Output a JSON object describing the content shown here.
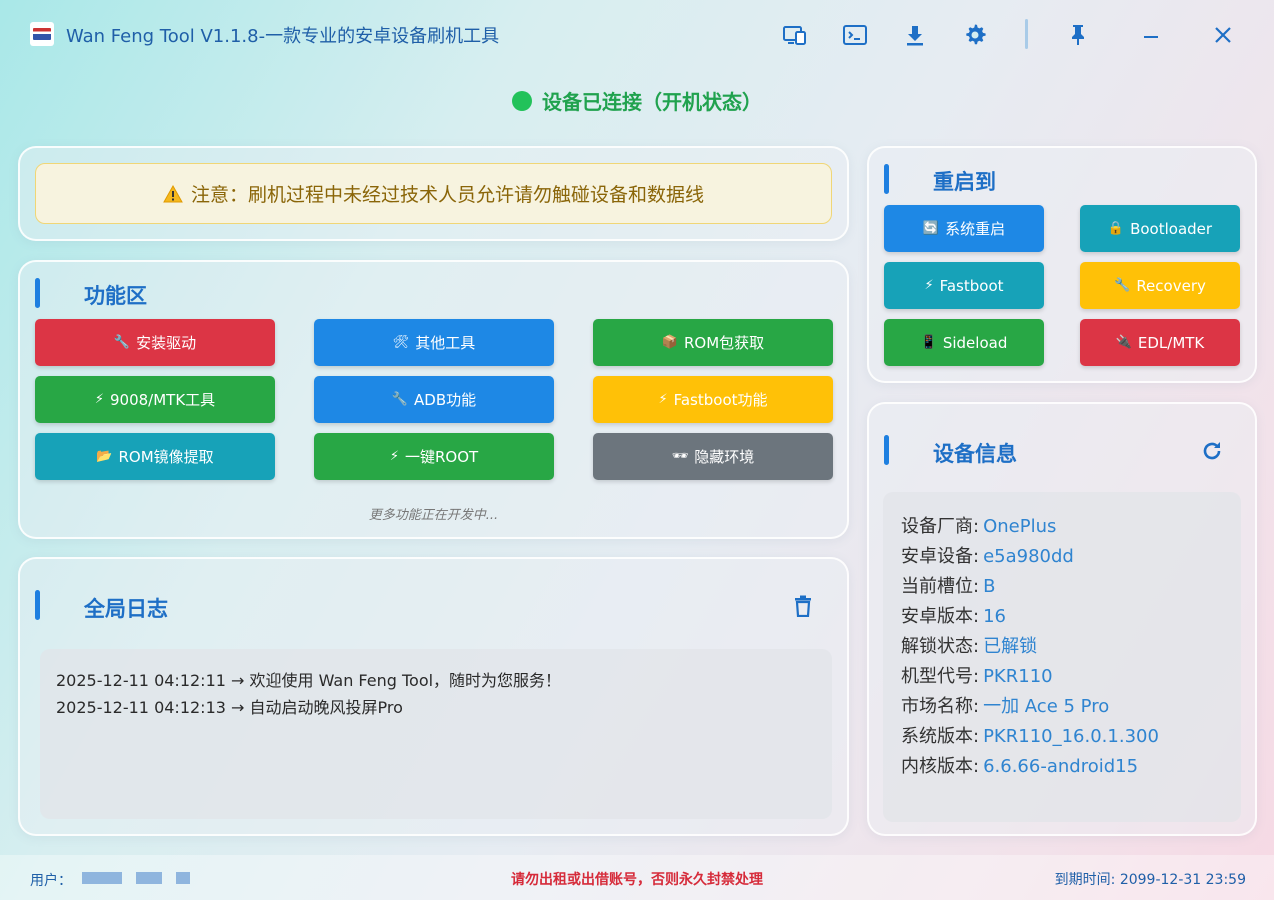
{
  "app": {
    "title": "Wan Feng Tool V1.1.8-一款专业的安卓设备刷机工具"
  },
  "status": {
    "text": "设备已连接（开机状态）",
    "color": "#22c25a"
  },
  "warning": {
    "text": "注意：刷机过程中未经过技术人员允许请勿触碰设备和数据线"
  },
  "functions": {
    "title": "功能区",
    "buttons": [
      {
        "label": "安装驱动",
        "icon": "wrench-icon",
        "glyph": "🔧"
      },
      {
        "label": "其他工具",
        "icon": "tools-icon",
        "glyph": "🛠"
      },
      {
        "label": "ROM包获取",
        "icon": "package-icon",
        "glyph": "📦"
      },
      {
        "label": "9008/MTK工具",
        "icon": "lightning-icon",
        "glyph": "⚡"
      },
      {
        "label": "ADB功能",
        "icon": "wrench-icon",
        "glyph": "🔧"
      },
      {
        "label": "Fastboot功能",
        "icon": "lightning-icon",
        "glyph": "⚡"
      },
      {
        "label": "ROM镜像提取",
        "icon": "folder-icon",
        "glyph": "📂"
      },
      {
        "label": "一键ROOT",
        "icon": "lightning-icon",
        "glyph": "⚡"
      },
      {
        "label": "隐藏环境",
        "icon": "glasses-icon",
        "glyph": "🕶"
      }
    ],
    "more": "更多功能正在开发中..."
  },
  "reboot": {
    "title": "重启到",
    "buttons": [
      {
        "label": "系统重启",
        "icon": "reload-icon",
        "glyph": "🔄"
      },
      {
        "label": "Bootloader",
        "icon": "lock-icon",
        "glyph": "🔒"
      },
      {
        "label": "Fastboot",
        "icon": "lightning-icon",
        "glyph": "⚡"
      },
      {
        "label": "Recovery",
        "icon": "wrench-icon",
        "glyph": "🔧"
      },
      {
        "label": "Sideload",
        "icon": "phone-icon",
        "glyph": "📱"
      },
      {
        "label": "EDL/MTK",
        "icon": "plug-icon",
        "glyph": "🔌"
      }
    ]
  },
  "log": {
    "title": "全局日志",
    "lines": [
      "2025-12-11 04:12:11 → 欢迎使用 Wan Feng Tool，随时为您服务！",
      "2025-12-11 04:12:13 → 自动启动晚风投屏Pro"
    ]
  },
  "device": {
    "title": "设备信息",
    "rows": [
      {
        "label": "设备厂商:",
        "value": "OnePlus"
      },
      {
        "label": "安卓设备:",
        "value": "e5a980dd"
      },
      {
        "label": "当前槽位:",
        "value": "B"
      },
      {
        "label": "安卓版本:",
        "value": "16"
      },
      {
        "label": "解锁状态:",
        "value": "已解锁"
      },
      {
        "label": "机型代号:",
        "value": "PKR110"
      },
      {
        "label": "市场名称:",
        "value": "一加 Ace 5 Pro"
      },
      {
        "label": "系统版本:",
        "value": "PKR110_16.0.1.300"
      },
      {
        "label": "内核版本:",
        "value": "6.6.66-android15"
      }
    ]
  },
  "footer": {
    "user_label": "用户：",
    "warning": "请勿出租或出借账号，否则永久封禁处理",
    "expire": "到期时间: 2099-12-31 23:59"
  }
}
